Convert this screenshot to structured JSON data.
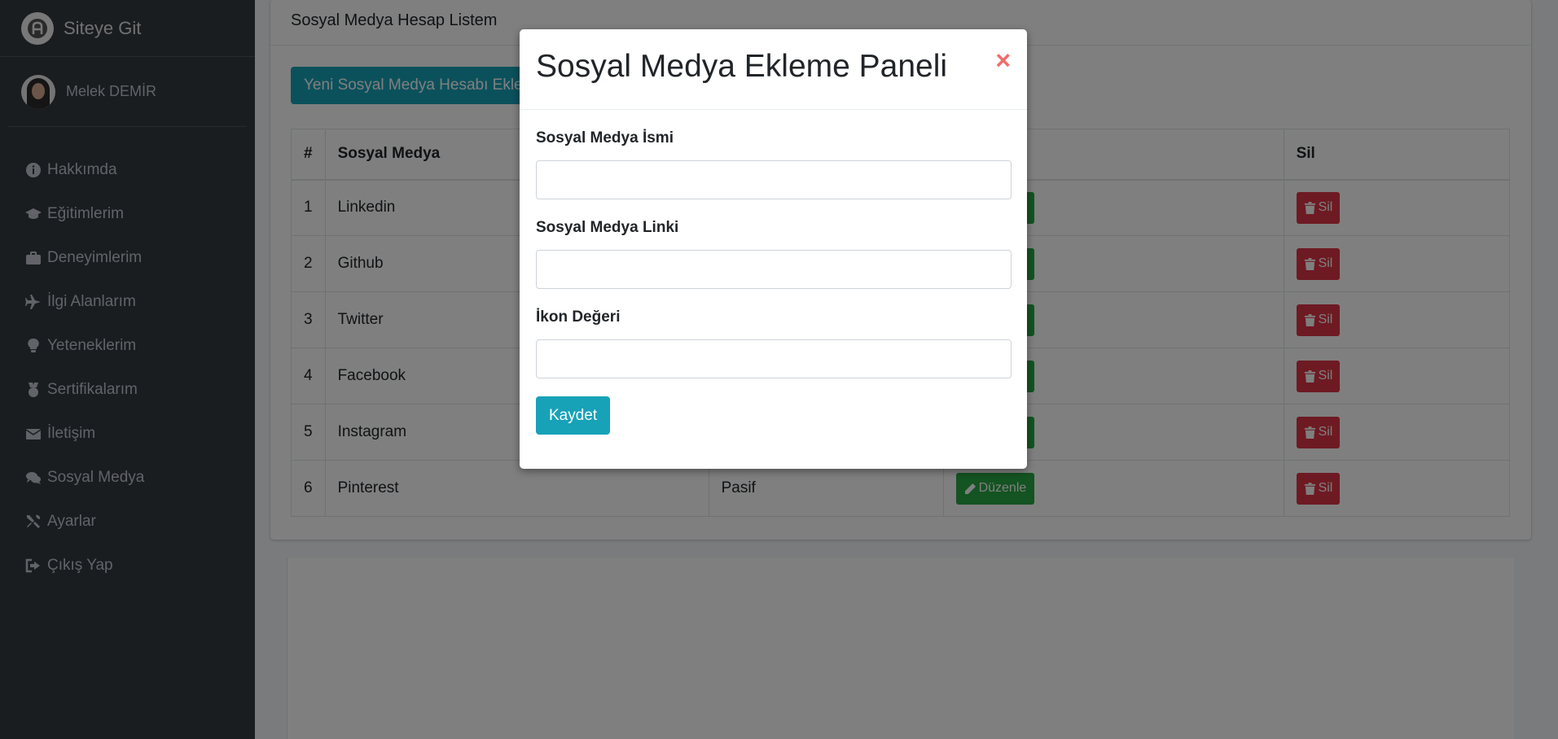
{
  "sidebar": {
    "brand": "Siteye Git",
    "user_name": "Melek DEMİR",
    "items": [
      {
        "label": "Hakkımda",
        "icon": "info-circle-icon"
      },
      {
        "label": "Eğitimlerim",
        "icon": "graduation-cap-icon"
      },
      {
        "label": "Deneyimlerim",
        "icon": "briefcase-icon"
      },
      {
        "label": "İlgi Alanlarım",
        "icon": "plane-icon"
      },
      {
        "label": "Yeteneklerim",
        "icon": "lightbulb-icon"
      },
      {
        "label": "Sertifikalarım",
        "icon": "medal-icon"
      },
      {
        "label": "İletişim",
        "icon": "envelope-icon"
      },
      {
        "label": "Sosyal Medya",
        "icon": "comments-icon"
      },
      {
        "label": "Ayarlar",
        "icon": "tools-icon"
      },
      {
        "label": "Çıkış Yap",
        "icon": "sign-out-icon"
      }
    ]
  },
  "card": {
    "title": "Sosyal Medya Hesap Listem",
    "add_button": "Yeni Sosyal Medya Hesabı Ekle"
  },
  "table": {
    "headers": [
      "#",
      "Sosyal Medya",
      "",
      "",
      "Sil"
    ],
    "rows": [
      {
        "num": "1",
        "name": "Linkedin",
        "status": ""
      },
      {
        "num": "2",
        "name": "Github",
        "status": ""
      },
      {
        "num": "3",
        "name": "Twitter",
        "status": ""
      },
      {
        "num": "4",
        "name": "Facebook",
        "status": ""
      },
      {
        "num": "5",
        "name": "Instagram",
        "status": ""
      },
      {
        "num": "6",
        "name": "Pinterest",
        "status": "Pasif"
      }
    ],
    "edit_label": "Düzenle",
    "delete_label": "Sil"
  },
  "modal": {
    "title": "Sosyal Medya Ekleme Paneli",
    "close": "×",
    "fields": [
      {
        "label": "Sosyal Medya İsmi",
        "value": ""
      },
      {
        "label": "Sosyal Medya Linki",
        "value": ""
      },
      {
        "label": "İkon Değeri",
        "value": ""
      }
    ],
    "save_label": "Kaydet"
  },
  "colors": {
    "sidebar_bg": "#343a40",
    "info": "#17a2b8",
    "success": "#28a745",
    "danger": "#dc3545"
  }
}
